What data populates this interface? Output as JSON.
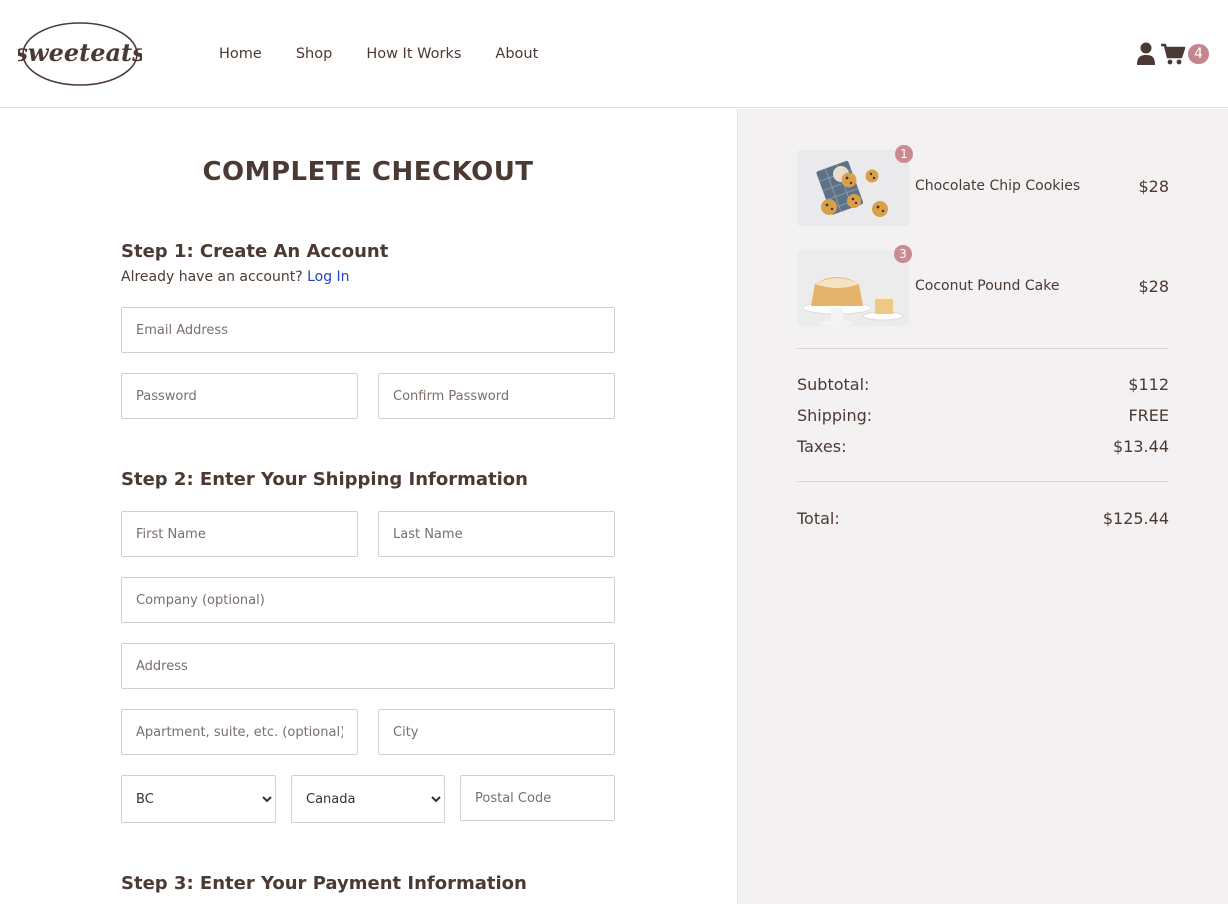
{
  "brand": {
    "logo_text": "sweeteats"
  },
  "nav": {
    "items": [
      "Home",
      "Shop",
      "How It Works",
      "About"
    ]
  },
  "cart": {
    "count": "4"
  },
  "checkout": {
    "title": "COMPLETE CHECKOUT",
    "step1": {
      "title": "Step 1: Create An Account",
      "prompt": "Already have an account?",
      "login_link": "Log In",
      "email_placeholder": "Email Address",
      "password_placeholder": "Password",
      "confirm_placeholder": "Confirm Password"
    },
    "step2": {
      "title": "Step 2: Enter Your Shipping Information",
      "first_name_placeholder": "First Name",
      "last_name_placeholder": "Last Name",
      "company_placeholder": "Company (optional)",
      "address_placeholder": "Address",
      "apartment_placeholder": "Apartment, suite, etc. (optional)",
      "city_placeholder": "City",
      "province_selected": "BC",
      "country_selected": "Canada",
      "postal_placeholder": "Postal Code"
    },
    "step3": {
      "title": "Step 3: Enter Your Payment Information"
    }
  },
  "summary": {
    "items": [
      {
        "name": "Chocolate Chip Cookies",
        "price": "$28",
        "qty": "1"
      },
      {
        "name": "Coconut Pound Cake",
        "price": "$28",
        "qty": "3"
      }
    ],
    "subtotal_label": "Subtotal:",
    "subtotal": "$112",
    "shipping_label": "Shipping:",
    "shipping": "FREE",
    "taxes_label": "Taxes:",
    "taxes": "$13.44",
    "total_label": "Total:",
    "total": "$125.44"
  },
  "colors": {
    "text": "#4b3a33",
    "accent": "#c4868a",
    "link": "#2145c7",
    "summary_bg": "#f3f1f1"
  }
}
